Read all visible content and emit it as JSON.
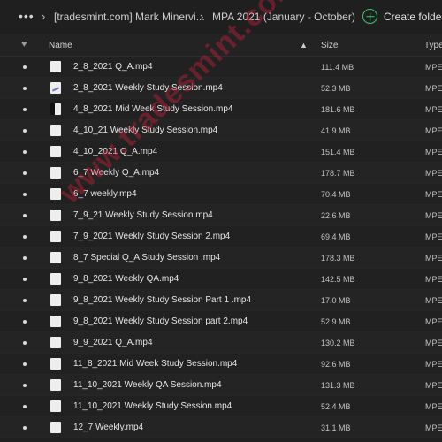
{
  "topbar": {
    "more_icon": "more-horizontal-icon",
    "separator_icon": "chevron-right-icon",
    "breadcrumbs": [
      "[tradesmint.com] Mark Minervi...",
      "MPA 2021 (January - October)"
    ],
    "create_folder_label": "Create folder",
    "create_folder_icon": "plus-circle-icon",
    "accent_color": "#3ec46d"
  },
  "table": {
    "favorite_icon": "heart-icon",
    "sort_icon": "sort-arrow-up-icon",
    "columns": {
      "name": "Name",
      "size": "Size",
      "type": "Type"
    },
    "rows": [
      {
        "name": "2_8_2021 Q_A.mp4",
        "size": "111.4 MB",
        "type": "MPEG"
      },
      {
        "name": "2_8_2021 Weekly Study Session.mp4",
        "size": "52.3 MB",
        "type": "MPEG"
      },
      {
        "name": "4_8_2021 Mid Week Study Session.mp4",
        "size": "181.6 MB",
        "type": "MPEG"
      },
      {
        "name": "4_10_21 Weekly Study Session.mp4",
        "size": "41.9 MB",
        "type": "MPEG"
      },
      {
        "name": "4_10_2021 Q_A.mp4",
        "size": "151.4 MB",
        "type": "MPEG"
      },
      {
        "name": "6_7 Weekly Q_A.mp4",
        "size": "178.7 MB",
        "type": "MPEG"
      },
      {
        "name": "6_7 weekly.mp4",
        "size": "70.4 MB",
        "type": "MPEG"
      },
      {
        "name": "7_9_21 Weekly Study Session.mp4",
        "size": "22.6 MB",
        "type": "MPEG"
      },
      {
        "name": "7_9_2021 Weekly Study Session 2.mp4",
        "size": "69.4 MB",
        "type": "MPEG"
      },
      {
        "name": "8_7 Special Q_A Study Session .mp4",
        "size": "178.3 MB",
        "type": "MPEG"
      },
      {
        "name": "9_8_2021 Weekly QA.mp4",
        "size": "142.5 MB",
        "type": "MPEG"
      },
      {
        "name": "9_8_2021 Weekly Study Session Part 1 .mp4",
        "size": "17.0 MB",
        "type": "MPEG"
      },
      {
        "name": "9_8_2021 Weekly Study Session part 2.mp4",
        "size": "52.9 MB",
        "type": "MPEG"
      },
      {
        "name": "9_9_2021 Q_A.mp4",
        "size": "130.2 MB",
        "type": "MPEG"
      },
      {
        "name": "11_8_2021 Mid Week Study Session.mp4",
        "size": "92.6 MB",
        "type": "MPEG"
      },
      {
        "name": "11_10_2021 Weekly QA Session.mp4",
        "size": "131.3 MB",
        "type": "MPEG"
      },
      {
        "name": "11_10_2021 Weekly Study Session.mp4",
        "size": "52.4 MB",
        "type": "MPEG"
      },
      {
        "name": "12_7 Weekly.mp4",
        "size": "31.1 MB",
        "type": "MPEG"
      }
    ]
  },
  "watermark": "www.tradesmint.com",
  "watermark_color": "#c81e3c"
}
